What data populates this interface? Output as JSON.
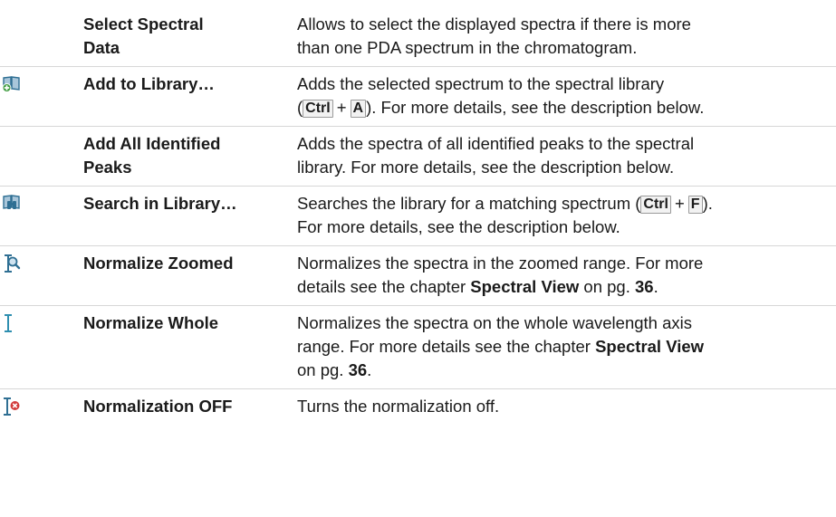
{
  "rows": [
    {
      "name_lines": [
        "Select Spectral",
        "Data"
      ],
      "desc_lines": [
        "Allows to select the displayed spectra if there is more",
        "than one PDA spectrum in the chromatogram."
      ]
    },
    {
      "icon": "add-to-library-icon",
      "name_lines": [
        "Add to Library…"
      ],
      "desc": {
        "line1": "Adds the selected spectrum to the spectral library",
        "line2_prefix": "(",
        "key1": "Ctrl",
        "plus": "+",
        "key2": "A",
        "line2_suffix": "). For more details, see the description below."
      }
    },
    {
      "name_lines": [
        "Add All Identified",
        "Peaks"
      ],
      "desc_lines": [
        "Adds the spectra of all identified peaks to the spectral",
        "library. For more details, see the description below."
      ]
    },
    {
      "icon": "search-in-library-icon",
      "name_lines": [
        "Search in Library…"
      ],
      "desc": {
        "line1_prefix": "Searches the library for a matching spectrum (",
        "key1": "Ctrl",
        "plus": "+",
        "key2": "F",
        "line1_suffix": ").",
        "line2": "For more details, see the description below."
      }
    },
    {
      "icon": "normalize-zoomed-icon",
      "name_lines": [
        "Normalize Zoomed"
      ],
      "desc": {
        "line1": "Normalizes the spectra in the zoomed range. For more",
        "line2_prefix": "details see the chapter ",
        "link": "Spectral View",
        "mid": " on pg. ",
        "page": "36",
        "end": "."
      }
    },
    {
      "icon": "normalize-whole-icon",
      "name_lines": [
        "Normalize Whole"
      ],
      "desc": {
        "line1": "Normalizes the spectra on the whole wavelength axis",
        "line2_prefix": "range. For more details see the chapter ",
        "link": "Spectral View",
        "line3_prefix": "on pg. ",
        "page": "36",
        "end": "."
      }
    },
    {
      "icon": "normalization-off-icon",
      "name_lines": [
        "Normalization OFF"
      ],
      "desc_lines": [
        "Turns the normalization off."
      ]
    }
  ]
}
